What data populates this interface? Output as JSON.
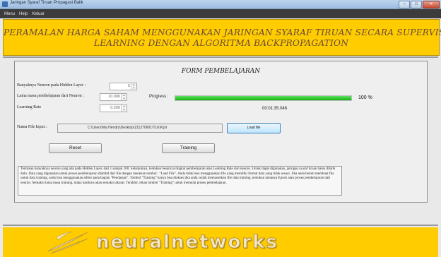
{
  "window": {
    "title": "Jaringan Syaraf Tiruan Propagasi Balik"
  },
  "menu": {
    "items": [
      "Menu",
      "Help",
      "Keluar"
    ]
  },
  "banner": {
    "line1": "PERAMALAN HARGA SAHAM MENGGUNAKAN JARINGAN SYARAF TIRUAN SECARA SUPERVISED",
    "line2": "LEARNING DENGAN ALGORITMA BACKPROPAGATION",
    "color": "#ffcc00"
  },
  "form": {
    "title": "FORM PEMBELAJARAN",
    "neuron_label": "Banyaknya Neuron pada Hidden Layer :",
    "neuron_value": "5",
    "duration_label": "Lama masa pembelajaran dari Neuron :",
    "duration_value": "10.000",
    "learning_rate_label": "Learning Rate",
    "learning_rate_value": "0.200",
    "progress_label": "Progress :",
    "progress_value": 1.0,
    "progress_text": "100 %",
    "progress_color": "#15b415",
    "elapsed": "00:01:35.046",
    "file_label": "Nama File Input :",
    "file_path": "C:\\Users\\Ma Hendry\\Desktop\\211270601\\TLKM.jst",
    "load_label": "Load file",
    "reset_label": "Reset",
    "training_label": "Training",
    "help_text": "Tentukan banyaknya neuron yang ada pada Hidden Layer, dari 1 sampai 100. Selanjutnya, tentukan besarnya tingkat pembelajaran atau Learning Rate dari neuron. Untuk dapat digunakan, jaringan syaraf tiruan harus dilatih dulu. Data yang digunakan untuk proses pembelajaran diambil dari file dengan menekan tombol : \"Load File\". Anda tidak bisa menggunakan file yang memiliki format data yang tidak sesuai. Jika anda belum membuat file untuk data training, anda bisa menggunakan editor pada bagian \"Pendataan\". Tombol \"Training\" hanya bisa diakses jika anda sudah memasukkan file data training, tentukan lamanya Epoch atau proses pembelajaran dari neuron. Semakin lama masa training, maka hasilnya akan semakin akurat. Terakhir, tekan tombol \"Training\" untuk memulai proses pembelajaran."
  },
  "footer": {
    "logo_text": "neuralnetworks",
    "logo_icon": "swoosh-logo-icon"
  }
}
